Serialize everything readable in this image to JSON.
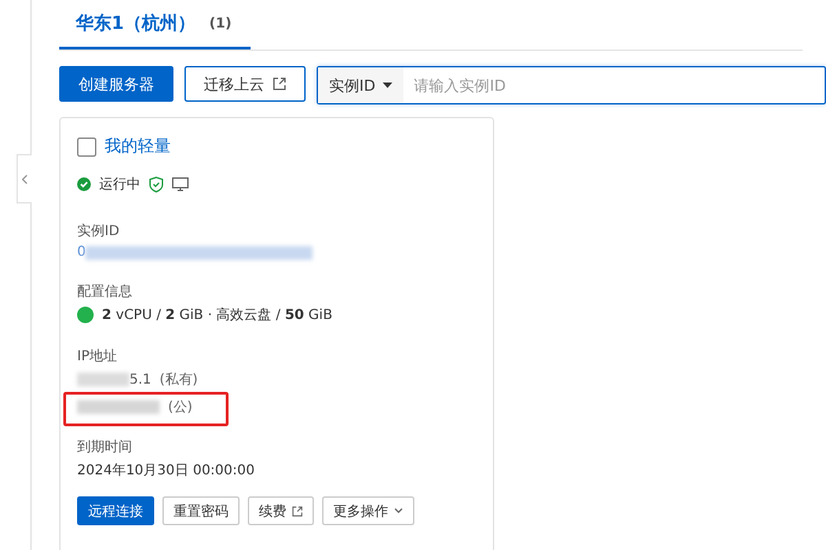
{
  "tabs": [
    {
      "label": "华东1（杭州）",
      "count": "(1)",
      "selected": true
    }
  ],
  "toolbar": {
    "primary": "创建服务器",
    "migrate": "迁移上云",
    "filter": "实例ID",
    "placeholder": "请输入实例ID"
  },
  "card": {
    "name": "我的轻量",
    "checked": false,
    "status": "运行中",
    "id_label": "实例ID",
    "id_prefix": "0",
    "config_label": "配置信息",
    "config": "**2** vCPU / **2** GiB · 高效云盘 / **50** GiB",
    "ip_label": "IP地址",
    "private_ip_tail": "5.1",
    "private_tag": "(私有)",
    "public_tag": "(公)",
    "expiry_label": "到期时间",
    "expiry": "2024年10月30日 00:00:00",
    "actions": [
      {
        "label": "远程连接",
        "kind": "primary"
      },
      {
        "label": "重置密码",
        "kind": "plain"
      },
      {
        "label": "续费",
        "kind": "external"
      },
      {
        "label": "更多操作",
        "kind": "menu"
      }
    ]
  }
}
